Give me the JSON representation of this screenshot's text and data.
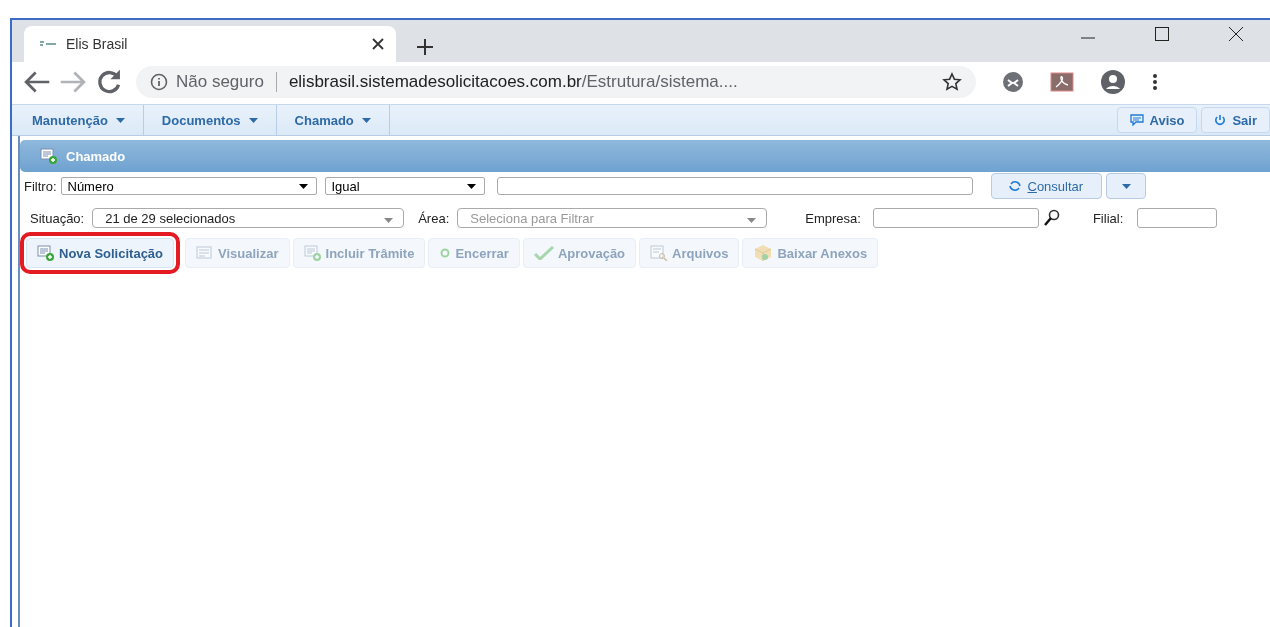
{
  "browser": {
    "tab_title": "Elis Brasil",
    "security": "Não seguro",
    "url_host": "elisbrasil.sistemadesolicitacoes.com.br",
    "url_path": "/Estrutura/sistema...."
  },
  "menu": {
    "items": [
      {
        "label": "Manutenção"
      },
      {
        "label": "Documentos"
      },
      {
        "label": "Chamado"
      }
    ],
    "right_buttons": [
      {
        "label": "Aviso",
        "kind": "notice"
      },
      {
        "label": "Sair",
        "kind": "power"
      }
    ]
  },
  "panel": {
    "title": "Chamado"
  },
  "filter": {
    "label": "Filtro:",
    "field": "Número",
    "operator": "Igual",
    "search_button": "Consultar"
  },
  "filters2": {
    "situacao_label": "Situação:",
    "situacao_value": "21 de 29 selecionados",
    "area_label": "Área:",
    "area_placeholder": "Seleciona para Filtrar",
    "empresa_label": "Empresa:",
    "filial_label": "Filial:"
  },
  "actions": [
    {
      "label": "Nova Solicitação",
      "kind": "new",
      "disabled": false,
      "highlighted": true
    },
    {
      "label": "Visualizar",
      "kind": "view",
      "disabled": true,
      "highlighted": false
    },
    {
      "label": "Incluir Trâmite",
      "kind": "new",
      "disabled": true,
      "highlighted": false
    },
    {
      "label": "Encerrar",
      "kind": "close",
      "disabled": true,
      "highlighted": false
    },
    {
      "label": "Aprovação",
      "kind": "approve",
      "disabled": true,
      "highlighted": false
    },
    {
      "label": "Arquivos",
      "kind": "files",
      "disabled": true,
      "highlighted": false
    },
    {
      "label": "Baixar Anexos",
      "kind": "download",
      "disabled": true,
      "highlighted": false
    }
  ]
}
